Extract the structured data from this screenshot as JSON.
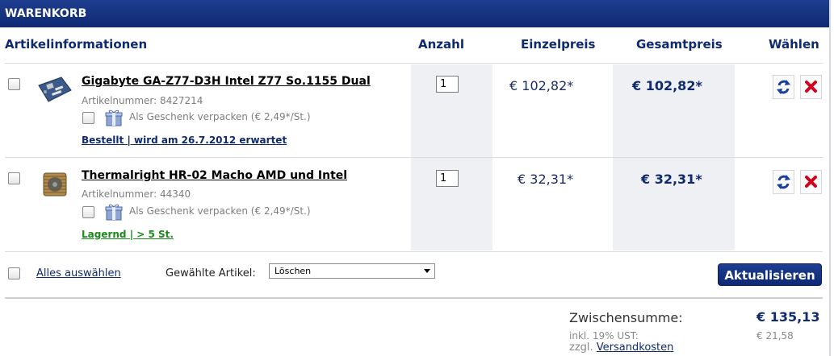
{
  "header": {
    "title": "WARENKORB"
  },
  "columns": {
    "info": "Artikelinformationen",
    "qty": "Anzahl",
    "unit_price": "Einzelpreis",
    "total_price": "Gesamtpreis",
    "choose": "Wählen"
  },
  "items": [
    {
      "title": "Gigabyte GA-Z77-D3H Intel Z77 So.1155 Dual",
      "article_number": "Artikelnummer: 8427214",
      "gift_wrap": "Als Geschenk verpacken (€ 2,49*/St.)",
      "status": "Bestellt | wird am 26.7.2012 erwartet",
      "status_color": "#102a6e",
      "quantity": "1",
      "unit_price": "€ 102,82*",
      "total_price": "€ 102,82*"
    },
    {
      "title": "Thermalright HR-02 Macho AMD und Intel",
      "article_number": "Artikelnummer: 44340",
      "gift_wrap": "Als Geschenk verpacken (€ 2,49*/St.)",
      "status": "Lagernd | > 5 St.",
      "status_color": "#1a8a1a",
      "quantity": "1",
      "unit_price": "€ 32,31*",
      "total_price": "€ 32,31*"
    }
  ],
  "footer": {
    "select_all": "Alles auswählen",
    "selected_label": "Gewählte Artikel:",
    "action_value": "Löschen",
    "update_button": "Aktualisieren"
  },
  "summary": {
    "subtotal_label": "Zwischensumme:",
    "subtotal_value": "€ 135,13",
    "tax_label": "inkl. 19% UST:",
    "tax_value": "€ 21,58",
    "shipping_prefix": "zzgl.",
    "shipping_link": "Versandkosten"
  },
  "colors": {
    "brand": "#102a6e",
    "header": "#1a3788",
    "in_stock": "#1a8a1a",
    "delete": "#d0021b"
  },
  "icons": [
    "gift-icon",
    "refresh-icon",
    "delete-icon",
    "motherboard-thumbnail",
    "cpu-cooler-thumbnail"
  ]
}
